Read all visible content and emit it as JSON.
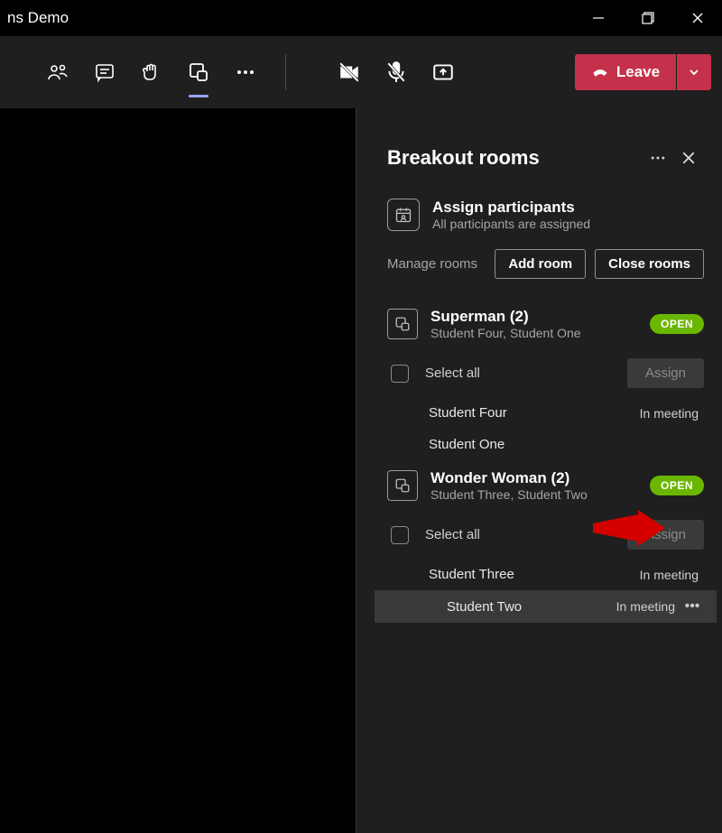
{
  "window": {
    "title": "ns Demo"
  },
  "toolbar": {
    "leave_label": "Leave"
  },
  "panel": {
    "title": "Breakout rooms",
    "assign": {
      "title": "Assign participants",
      "subtitle": "All participants are assigned"
    },
    "manage_label": "Manage rooms",
    "add_room_label": "Add room",
    "close_rooms_label": "Close rooms",
    "select_all_label": "Select all",
    "assign_btn_label": "Assign",
    "rooms": [
      {
        "name": "Superman (2)",
        "members_line": "Student Four, Student One",
        "status": "OPEN",
        "members": [
          {
            "name": "Student Four",
            "status": "In meeting"
          },
          {
            "name": "Student One",
            "status": ""
          }
        ]
      },
      {
        "name": "Wonder Woman (2)",
        "members_line": "Student Three, Student Two",
        "status": "OPEN",
        "members": [
          {
            "name": "Student Three",
            "status": "In meeting"
          },
          {
            "name": "Student Two",
            "status": "In meeting"
          }
        ]
      }
    ]
  }
}
